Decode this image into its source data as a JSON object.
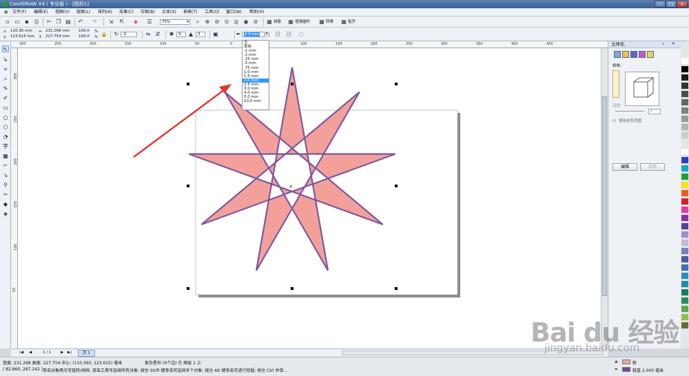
{
  "title": "CorelDRAW X4 ( 专业版 ) - [图形1]",
  "menu": [
    "文件(F)",
    "编辑(E)",
    "视图(V)",
    "版面(L)",
    "排列(A)",
    "效果(C)",
    "位图(B)",
    "文本(X)",
    "表格(T)",
    "工具(O)",
    "窗口(W)",
    "帮助(H)"
  ],
  "standard": {
    "zoom": "75%",
    "labels": [
      "排版",
      "增强插件",
      "转换",
      "贴齐"
    ]
  },
  "property": {
    "x": "110.36 mm",
    "y": "123.615 mm",
    "w": "231.268 mm",
    "h": "227.754 mm",
    "sx": "100.0",
    "sy": "100.0",
    "pct": "%",
    "rot": ".0",
    "pts": "9",
    "sharp": "3",
    "outline": "2.0 mm"
  },
  "outline_options": [
    "无",
    "发丝",
    ".1 mm",
    ".2 mm",
    ".25 mm",
    ".5 mm",
    ".75 mm",
    "1.0 mm",
    "1.5 mm",
    "2.0 mm",
    "2.5 mm",
    "3.0 mm",
    "4.0 mm",
    "5.0 mm",
    "10.0 mm"
  ],
  "outline_selected_index": 9,
  "hruler": [
    "300",
    "250",
    "200",
    "150",
    "100",
    "50",
    "0",
    "50",
    "100",
    "150",
    "200",
    "250",
    "300",
    "350",
    "400",
    "450"
  ],
  "vruler": [
    "300",
    "250",
    "200",
    "150",
    "100",
    "50"
  ],
  "docker": {
    "title": "立体化",
    "section": "斜角:",
    "depth_label": "深度:",
    "depth_value": "0",
    "use_full_color": "使用全色范围",
    "edit": "编辑",
    "apply": "应用"
  },
  "page": {
    "count": "1 / 1",
    "tab": "页 1"
  },
  "status": {
    "line1": "宽度: 231.268 高度: 227.754 中心: (110.360, 123.615) 毫米",
    "object": "复杂星形 (9个边) 在 图层 1 上",
    "line2_coord": "( 82.860, 287.242 )",
    "line2_hint": "单击对象两次可旋转/倾斜; 双击工具可选择所有对象; 按住 Shift 键单击可选择多个对象; 按住 Alt 键单击可进行挖掘; 按住 Ctrl 并单...",
    "fill_label": "粉",
    "outline_label": "鞋篮  2.000 毫米"
  },
  "colors": {
    "star_fill": "#f4a09a",
    "star_stroke": "#7a57a0",
    "fill_swatch": "#f4a09a",
    "outline_swatch": "#6a4c98"
  },
  "watermark": {
    "text": "Bai du 经验",
    "url": "jingyan.baidu.com"
  }
}
